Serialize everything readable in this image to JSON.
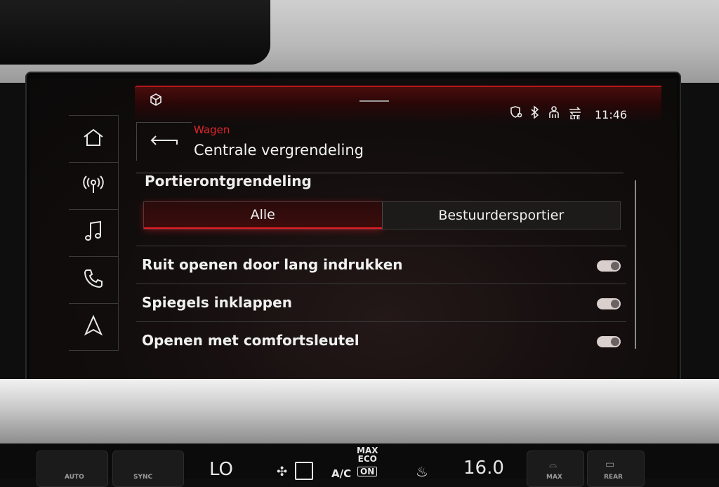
{
  "status": {
    "time": "11:46",
    "lte_label": "LTE",
    "icons": [
      "cube-icon",
      "location-shield-icon",
      "bluetooth-icon",
      "person-icon",
      "lte-signal-icon"
    ]
  },
  "sidebar": {
    "items": [
      {
        "icon": "home-icon"
      },
      {
        "icon": "radio-icon"
      },
      {
        "icon": "music-note-icon"
      },
      {
        "icon": "phone-icon"
      },
      {
        "icon": "navigation-icon"
      }
    ]
  },
  "header": {
    "breadcrumb": "Wagen",
    "title": "Centrale vergrendeling",
    "back_icon": "back-arrow-icon"
  },
  "door_unlock": {
    "label": "Portierontgrendeling",
    "options": [
      "Alle",
      "Bestuurdersportier"
    ],
    "selected": "Alle"
  },
  "settings": [
    {
      "label": "Ruit openen door lang indrukken",
      "enabled": true
    },
    {
      "label": "Spiegels inklappen",
      "enabled": true
    },
    {
      "label": "Openen met comfortsleutel",
      "enabled": true
    }
  ],
  "climate": {
    "left_temp": "LO",
    "ac_label": "A/C",
    "on_label": "ON",
    "max_eco_label": "MAX\nECO",
    "right_temp": "16.0",
    "max_label": "MAX",
    "rear_label": "REAR",
    "auto_label": "AUTO",
    "sync_label": "SYNC"
  },
  "colors": {
    "accent_red": "#e01f26",
    "text": "#f0f0f0",
    "toggle_on": "#d9cfcd"
  }
}
